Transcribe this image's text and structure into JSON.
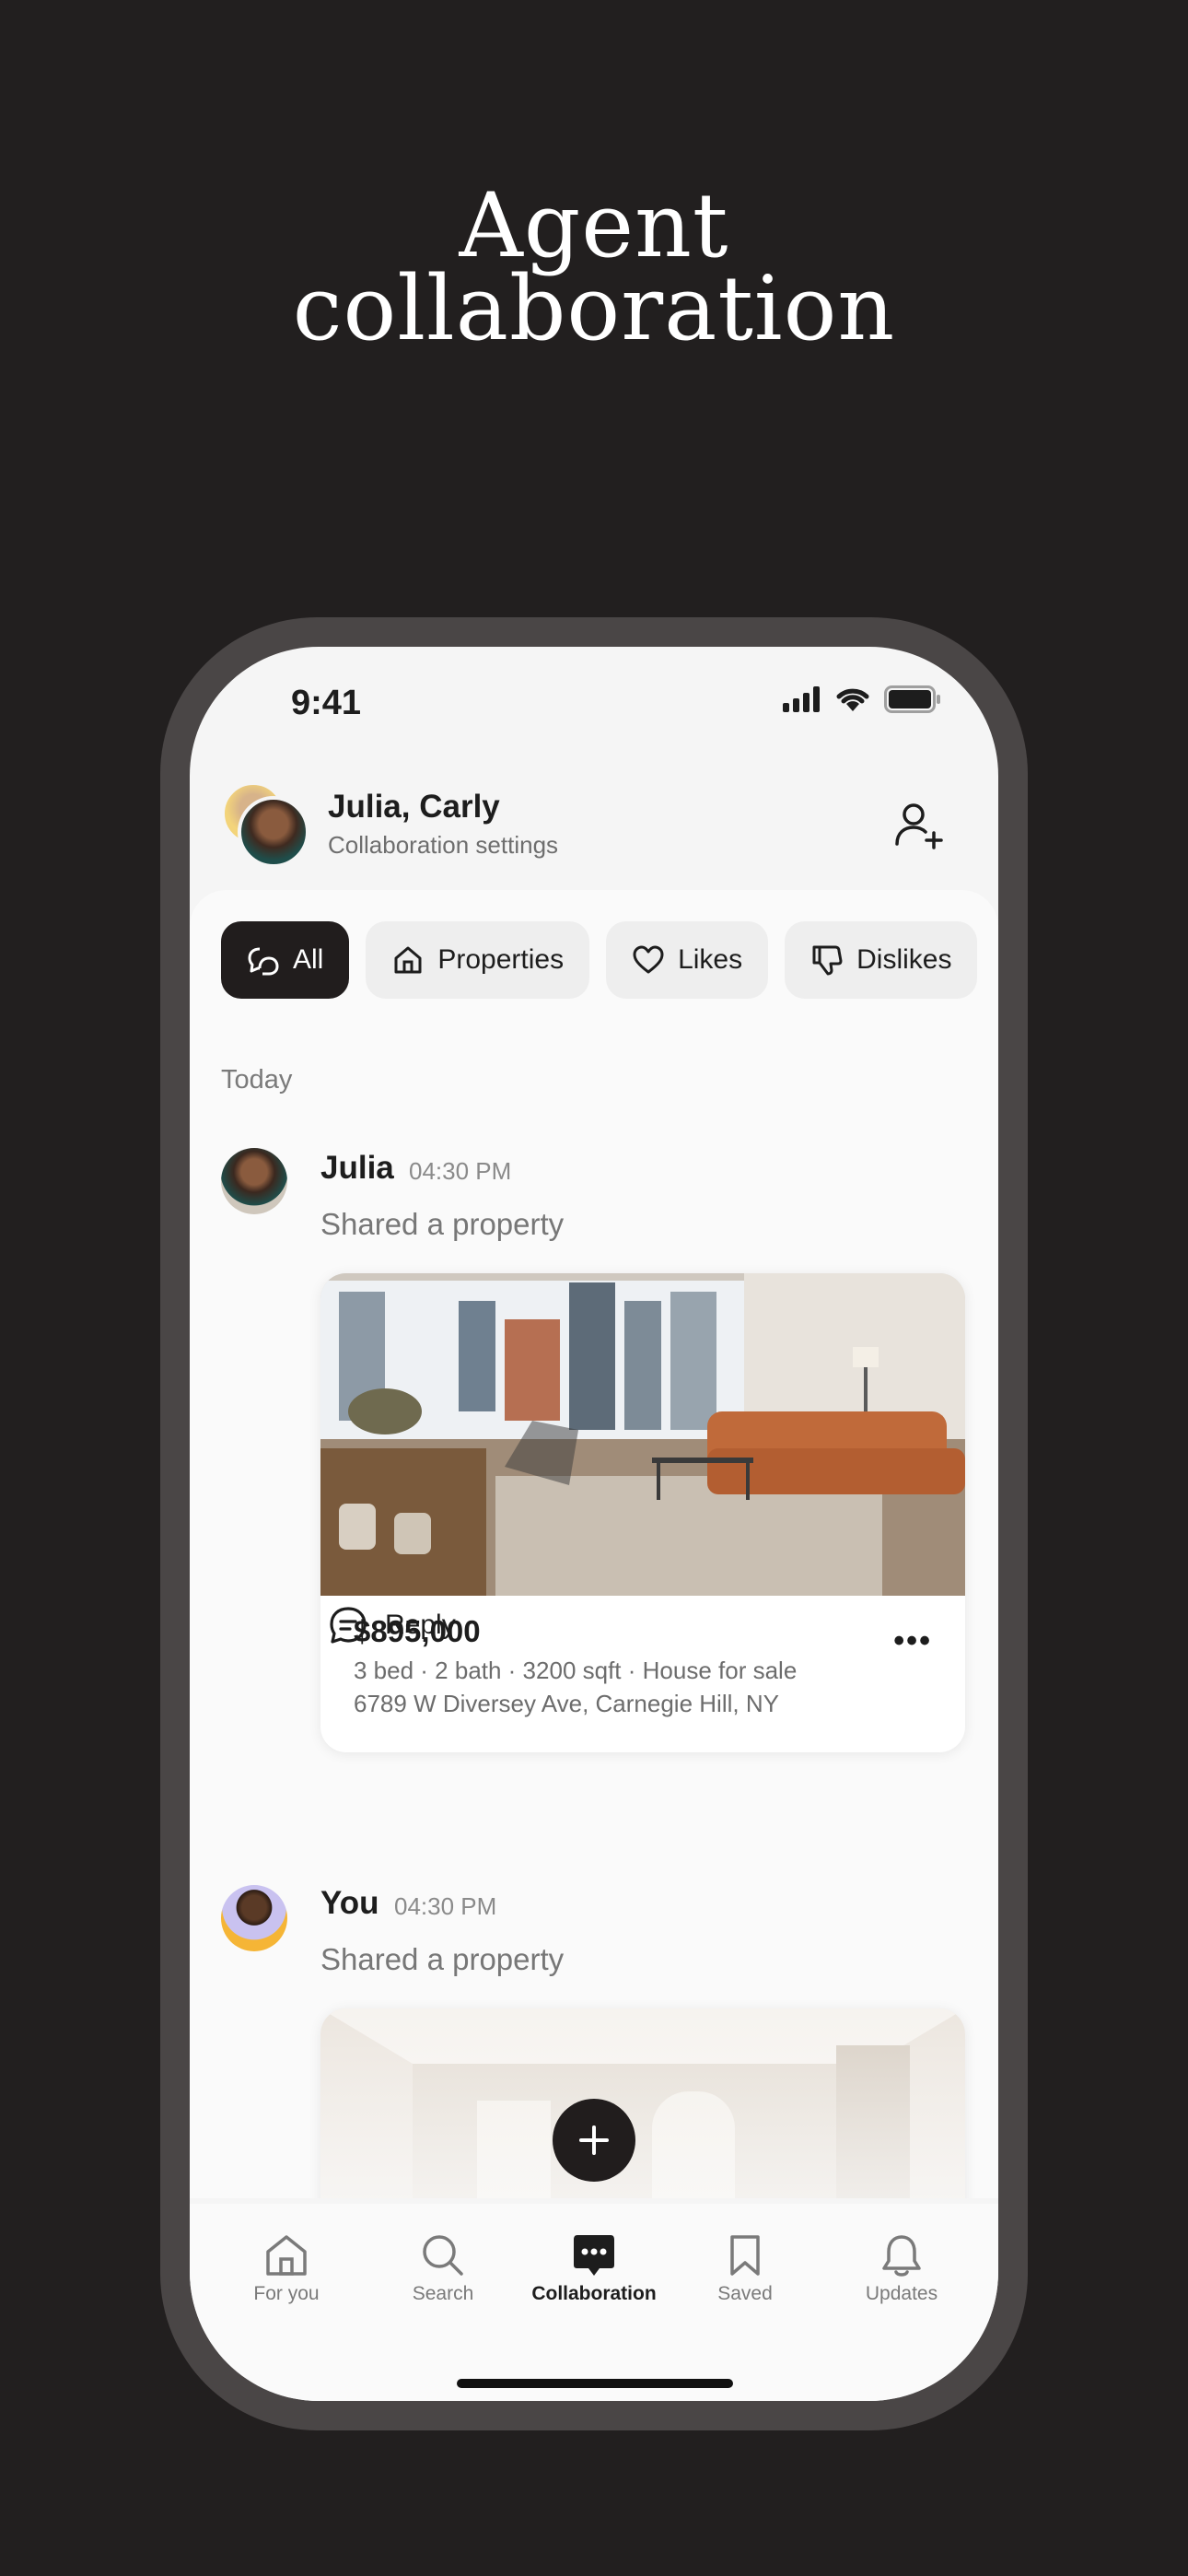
{
  "promo": {
    "title_line1": "Agent",
    "title_line2": "collaboration"
  },
  "status_bar": {
    "time": "9:41"
  },
  "header": {
    "title": "Julia, Carly",
    "subtitle": "Collaboration settings"
  },
  "filters": [
    {
      "label": "All",
      "icon": "chat-bubbles-icon",
      "active": true
    },
    {
      "label": "Properties",
      "icon": "home-icon",
      "active": false
    },
    {
      "label": "Likes",
      "icon": "heart-icon",
      "active": false
    },
    {
      "label": "Dislikes",
      "icon": "thumbs-down-icon",
      "active": false
    }
  ],
  "feed": {
    "section_label": "Today",
    "messages": [
      {
        "author": "Julia",
        "time": "04:30 PM",
        "text": "Shared a property",
        "listing": {
          "price": "$895,000",
          "details": "3 bed · 2 bath · 3200 sqft · House for sale",
          "address": "6789 W Diversey Ave, Carnegie Hill, NY"
        },
        "reply_label": "Reply"
      },
      {
        "author": "You",
        "time": "04:30 PM",
        "text": "Shared a property"
      }
    ]
  },
  "tab_bar": [
    {
      "label": "For you",
      "icon": "home-icon",
      "active": false
    },
    {
      "label": "Search",
      "icon": "search-icon",
      "active": false
    },
    {
      "label": "Collaboration",
      "icon": "chat-icon",
      "active": true
    },
    {
      "label": "Saved",
      "icon": "bookmark-icon",
      "active": false
    },
    {
      "label": "Updates",
      "icon": "bell-icon",
      "active": false
    }
  ],
  "colors": {
    "background": "#221f1f",
    "accent": "#211d1d",
    "frame": "#4a4646"
  }
}
